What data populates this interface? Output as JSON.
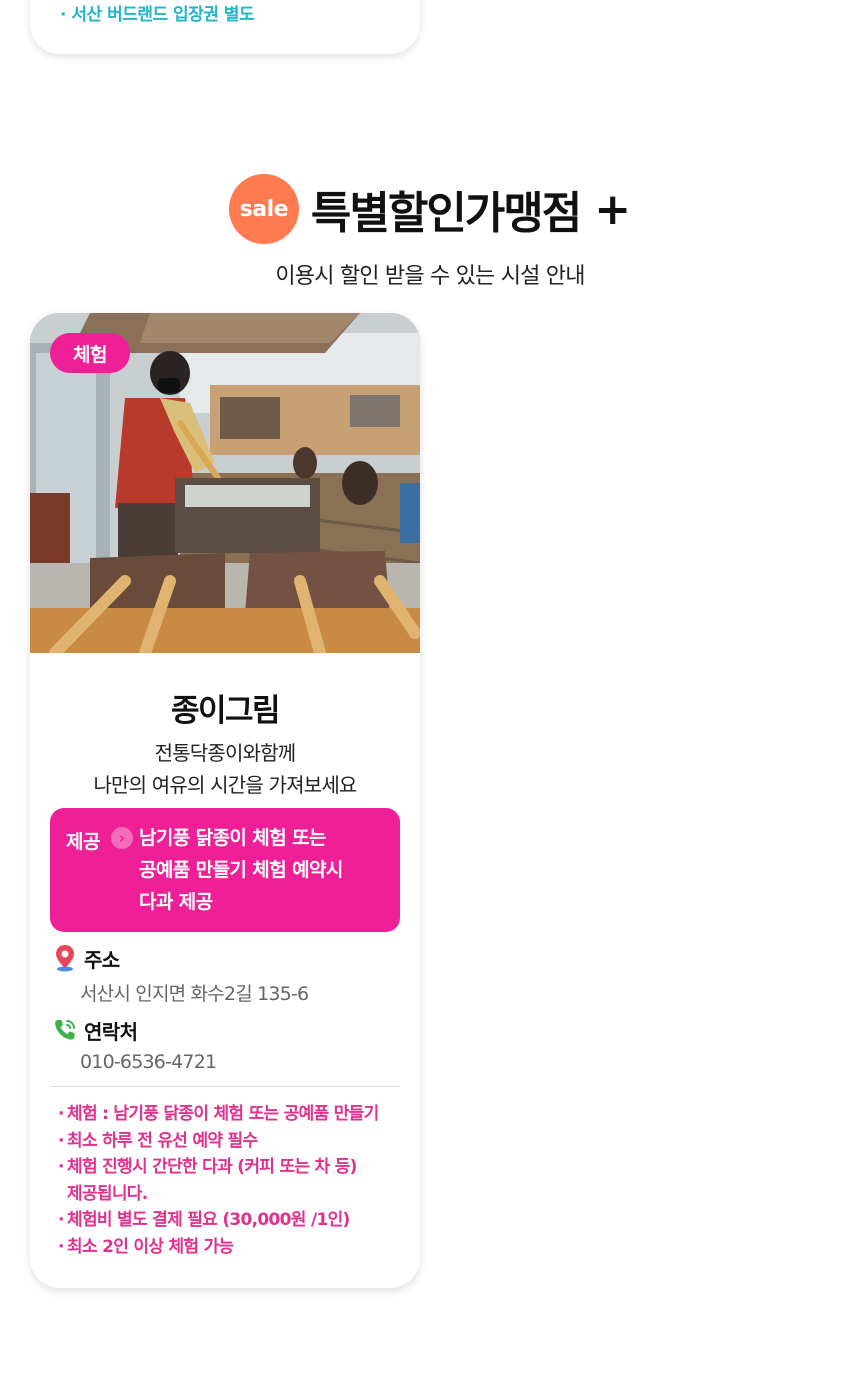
{
  "previous_card": {
    "note": "· 서산 버드랜드 입장권 별도"
  },
  "section": {
    "badge": "sale",
    "title": "특별할인가맹점",
    "plus": "+",
    "subtitle": "이용시 할인 받을 수 있는 시설 안내"
  },
  "card": {
    "category": "체험",
    "name": "종이그림",
    "description_lines": [
      "전통닥종이와함께",
      "나만의 여유의 시간을 가져보세요"
    ],
    "offer": {
      "label": "제공",
      "arrow_icon": "chevron-right-icon",
      "lines": [
        "남기풍 닭종이 체험 또는",
        "공예품 만들기 체험 예약시",
        "다과 제공"
      ]
    },
    "address": {
      "icon": "map-pin-icon",
      "title": "주소",
      "value": "서산시 인지면 화수2길 135-6"
    },
    "contact": {
      "icon": "phone-icon",
      "title": "연락처",
      "value": "010-6536-4721"
    },
    "notes": [
      "체험 : 남기풍 닭종이 체험 또는 공예품 만들기",
      "최소 하루 전 유선 예약 필수",
      "체험 진행시 간단한 다과 (커피 또는 차 등)",
      "제공됩니다.",
      "체험비 별도 결제 필요 (30,000원 /1인)",
      "최소 2인 이상 체험 가능"
    ]
  },
  "colors": {
    "accent_pink": "#ef1f97",
    "note_pink": "#e0318f",
    "sale_orange": "#ff7a4f",
    "note_teal": "#1fb6c6"
  }
}
